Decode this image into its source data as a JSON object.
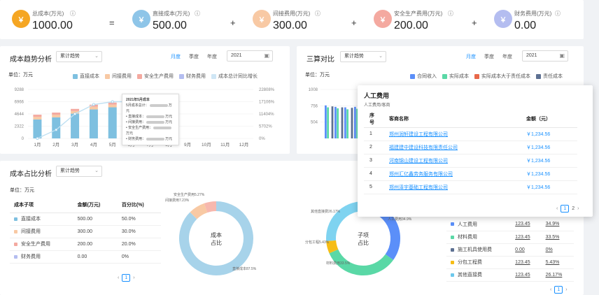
{
  "summary": [
    {
      "label": "总成本(万元)",
      "value": "1000.00",
      "icon": "coin-icon",
      "color": "#f5a623"
    },
    {
      "label": "直接成本(万元)",
      "value": "500.00",
      "icon": "coin-icon",
      "color": "#8ec5e8"
    },
    {
      "label": "间接费用(万元)",
      "value": "300.00",
      "icon": "coin-icon",
      "color": "#f8c9a4"
    },
    {
      "label": "安全生产费用(万元)",
      "value": "200.00",
      "icon": "coin-icon",
      "color": "#f4a9a0"
    },
    {
      "label": "财务费用(万元)",
      "value": "0.00",
      "icon": "coin-icon",
      "color": "#b4bdf0"
    }
  ],
  "operators": [
    "=",
    "+",
    "+",
    "+"
  ],
  "trend": {
    "title": "成本趋势分析",
    "select": "累计趋势",
    "tabs": [
      "月度",
      "季度",
      "年度"
    ],
    "active_tab": "月度",
    "year": "2021",
    "unit": "单位：万元",
    "legend": [
      {
        "name": "直接成本",
        "color": "#7ec0e0"
      },
      {
        "name": "间接费用",
        "color": "#f8c9a4"
      },
      {
        "name": "安全生产费用",
        "color": "#f4a9a0"
      },
      {
        "name": "财务费用",
        "color": "#b4bdf0"
      },
      {
        "name": "成本总计同比增长",
        "color": "#cfe6f5"
      }
    ],
    "y_left": [
      "9288",
      "6966",
      "4644",
      "2322",
      "0"
    ],
    "y_right": [
      "22808%",
      "17106%",
      "11404%",
      "5702%",
      "0%"
    ],
    "months": [
      "1月",
      "2月",
      "3月",
      "4月",
      "5月",
      "6月",
      "7月",
      "8月",
      "9月",
      "10月",
      "11月",
      "12月"
    ],
    "tooltip": {
      "title": "2021年5月成本",
      "lines": [
        "5月成本总计：",
        "直接成本：",
        "间接费用：",
        "安全生产费用：",
        "财务费用："
      ],
      "unit": "万元"
    }
  },
  "chart_data": [
    {
      "type": "bar",
      "title": "成本趋势分析",
      "categories": [
        "1月",
        "2月",
        "3月",
        "4月",
        "5月",
        "6月",
        "7月",
        "8月",
        "9月",
        "10月",
        "11月",
        "12月"
      ],
      "series": [
        {
          "name": "直接成本",
          "values": [
            3600,
            4000,
            4700,
            5500,
            5900,
            0,
            0,
            0,
            0,
            0,
            0,
            0
          ]
        },
        {
          "name": "间接费用",
          "values": [
            500,
            500,
            500,
            500,
            500,
            0,
            0,
            0,
            0,
            0,
            0,
            0
          ]
        },
        {
          "name": "安全生产费用",
          "values": [
            400,
            400,
            400,
            400,
            400,
            0,
            0,
            0,
            0,
            0,
            0,
            0
          ]
        },
        {
          "name": "财务费用",
          "values": [
            0,
            0,
            0,
            0,
            0,
            0,
            0,
            0,
            0,
            0,
            0,
            0
          ]
        }
      ],
      "line": {
        "name": "成本总计同比增长",
        "values": [
          0,
          4000,
          11400,
          15800,
          17100,
          17106,
          null,
          null,
          null,
          null,
          null,
          null
        ]
      },
      "ylim": [
        0,
        9288
      ],
      "ylim_right": [
        0,
        22808
      ]
    },
    {
      "type": "bar",
      "title": "三算对比",
      "categories": [
        "",
        "",
        "",
        "",
        ""
      ],
      "series": [
        {
          "name": "合同收入",
          "values": [
            680,
            650,
            640,
            650,
            660
          ]
        },
        {
          "name": "实际成本",
          "values": [
            640,
            620,
            600,
            610,
            620
          ]
        },
        {
          "name": "实际成本大于责任成本",
          "values": [
            0,
            0,
            0,
            0,
            0
          ]
        },
        {
          "name": "责任成本",
          "values": [
            660,
            640,
            630,
            640,
            650
          ]
        }
      ],
      "ylim": [
        0,
        1008
      ]
    },
    {
      "type": "pie",
      "title": "成本占比",
      "labels": [
        "直接成本",
        "间接费用",
        "安全生产费用",
        "财务费用"
      ],
      "values": [
        87.5,
        7.23,
        5.27,
        0
      ],
      "slice_labels": [
        "直接成本87.5%",
        "间接费用7.23%",
        "安全生产费用5.27%"
      ]
    },
    {
      "type": "pie",
      "title": "子项占比",
      "labels": [
        "人工费用",
        "材料费用",
        "施工机具使用费",
        "分包工程费",
        "其他直接费"
      ],
      "values": [
        34.9,
        33.5,
        0,
        5.43,
        26.17
      ],
      "slice_labels": [
        "人工费用34.9%",
        "材料费用33.5%",
        "分包工程5.43%",
        "其他直接费26.17%"
      ]
    }
  ],
  "compare": {
    "title": "三算对比",
    "select": "累计趋势",
    "tabs": [
      "月度",
      "季度",
      "年度"
    ],
    "year": "2021",
    "unit": "单位：万元",
    "legend": [
      {
        "name": "合同收入",
        "color": "#5b8ff9"
      },
      {
        "name": "实际成本",
        "color": "#5ad8a6"
      },
      {
        "name": "实际成本大于责任成本",
        "color": "#e8684a"
      },
      {
        "name": "责任成本",
        "color": "#5d7092"
      }
    ],
    "y": [
      "1008",
      "756",
      "504"
    ]
  },
  "ratio": {
    "title": "成本占比分析",
    "select": "累计趋势",
    "unit": "单位：万元",
    "headers": [
      "成本子项",
      "金额(万元)",
      "百分比(%)"
    ],
    "rows": [
      {
        "name": "直接成本",
        "amount": "500.00",
        "pct": "50.0%",
        "color": "#7ec0e0"
      },
      {
        "name": "间接费用",
        "amount": "300.00",
        "pct": "30.0%",
        "color": "#f8c9a4"
      },
      {
        "name": "安全生产费用",
        "amount": "200.00",
        "pct": "20.0%",
        "color": "#f4a9a0"
      },
      {
        "name": "财务费用",
        "amount": "0.00",
        "pct": "0%",
        "color": "#b4bdf0"
      }
    ],
    "page": "1",
    "donut_center": [
      "成本",
      "占比"
    ]
  },
  "sub": {
    "donut_center": [
      "子项",
      "占比"
    ],
    "rows": [
      {
        "name": "人工费用",
        "amount": "123.45",
        "pct": "34.9%",
        "color": "#5b8ff9"
      },
      {
        "name": "材料费用",
        "amount": "123.45",
        "pct": "33.5%",
        "color": "#5ad8a6"
      },
      {
        "name": "施工机具使用费",
        "amount": "0.00",
        "pct": "0%",
        "color": "#5d7092"
      },
      {
        "name": "分包工程费",
        "amount": "123.45",
        "pct": "5.43%",
        "color": "#f6bd16"
      },
      {
        "name": "其他直接费",
        "amount": "123.45",
        "pct": "26.17%",
        "color": "#6dc8ec"
      }
    ],
    "page": "1"
  },
  "popup": {
    "title": "人工费用",
    "subtitle": "人工费用/客商",
    "headers": [
      "序号",
      "客商名称",
      "金额（元）"
    ],
    "rows": [
      {
        "no": "1",
        "name": "郑州润轩建设工程有限公司",
        "amount": "￥1,234.56"
      },
      {
        "no": "2",
        "name": "福建建中建设科技有限责任公司",
        "amount": "￥1,234.56"
      },
      {
        "no": "3",
        "name": "河南锦山建设工程有限公司",
        "amount": "￥1,234.56"
      },
      {
        "no": "4",
        "name": "郑州汇亿鑫劳务服务有限公司",
        "amount": "￥1,234.56"
      },
      {
        "no": "5",
        "name": "郑州泽宇基础工程有限公司",
        "amount": "￥1,234.56"
      }
    ],
    "pages": [
      "1",
      "2"
    ]
  }
}
